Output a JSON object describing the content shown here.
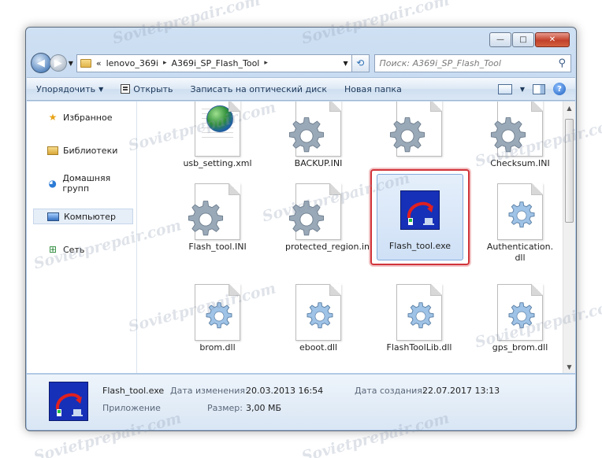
{
  "window": {
    "caption_buttons": {
      "minimize": "—",
      "maximize": "□",
      "close": "✕"
    }
  },
  "nav": {
    "back_icon": "◀",
    "forward_icon": "▶",
    "breadcrumb_prefix": "«",
    "path": [
      "lenovo_369i",
      "A369i_SP_Flash_Tool"
    ],
    "search_placeholder": "Поиск: A369i_SP_Flash_Tool"
  },
  "toolbar": {
    "organize": "Упорядочить",
    "open": "Открыть",
    "burn": "Записать на оптический диск",
    "new_folder": "Новая папка",
    "help": "?"
  },
  "sidebar": {
    "items": [
      {
        "label": "Избранное",
        "icon": "star-icon"
      },
      {
        "label": "Библиотеки",
        "icon": "libraries-icon"
      },
      {
        "label": "Домашняя групп",
        "icon": "homegroup-icon"
      },
      {
        "label": "Компьютер",
        "icon": "computer-icon"
      },
      {
        "label": "Сеть",
        "icon": "network-icon"
      }
    ]
  },
  "files": [
    {
      "name": "usb_setting.xml",
      "icon": "xml-file-icon"
    },
    {
      "name": "BACKUP.INI",
      "icon": "ini-file-icon"
    },
    {
      "name": "",
      "icon": "ini-file-icon"
    },
    {
      "name": "Checksum.INI",
      "icon": "ini-file-icon"
    },
    {
      "name": "Flash_tool.INI",
      "icon": "ini-file-icon"
    },
    {
      "name": "protected_region.ini",
      "icon": "ini-file-icon"
    },
    {
      "name": "Flash_tool.exe",
      "icon": "exe-file-icon",
      "selected": true
    },
    {
      "name": "Authentication.dll",
      "icon": "dll-file-icon"
    },
    {
      "name": "brom.dll",
      "icon": "dll-file-icon"
    },
    {
      "name": "eboot.dll",
      "icon": "dll-file-icon"
    },
    {
      "name": "FlashToolLib.dll",
      "icon": "dll-file-icon"
    },
    {
      "name": "gps_brom.dll",
      "icon": "dll-file-icon"
    }
  ],
  "details": {
    "name": "Flash_tool.exe",
    "type": "Приложение",
    "modified_label": "Дата изменения:",
    "modified_value": "20.03.2013 16:54",
    "size_label": "Размер:",
    "size_value": "3,00 МБ",
    "created_label": "Дата создания:",
    "created_value": "22.07.2017 13:13"
  },
  "watermark": "Sovietprepair.com",
  "colors": {
    "selection_outline": "#d0343a",
    "exe_background": "#1630b8"
  }
}
